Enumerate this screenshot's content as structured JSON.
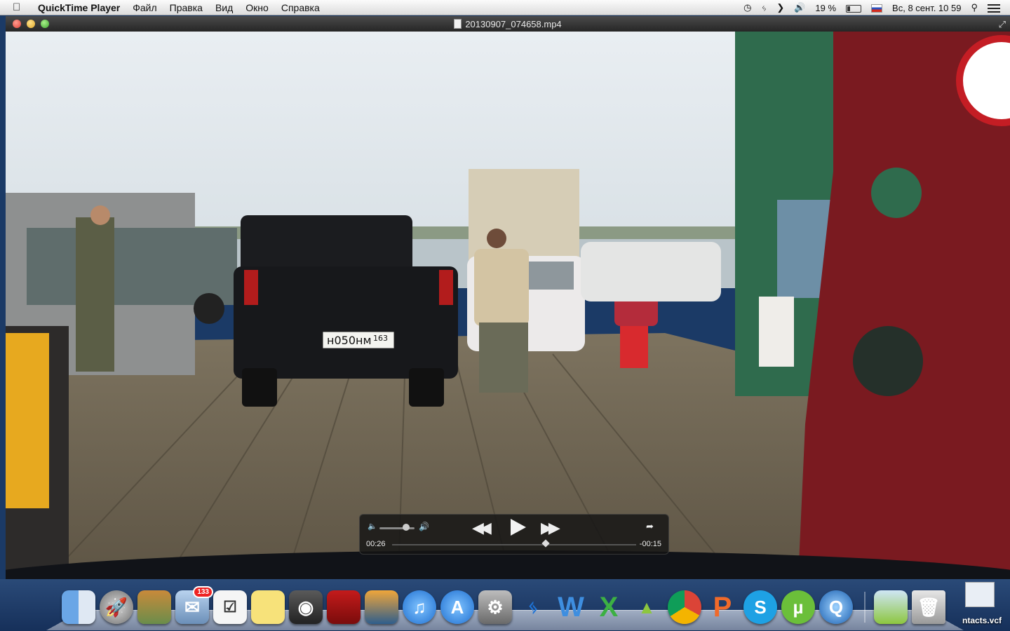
{
  "menubar": {
    "app_name": "QuickTime Player",
    "menus": [
      "Файл",
      "Правка",
      "Вид",
      "Окно",
      "Справка"
    ],
    "status": {
      "battery_percent": "19 %",
      "datetime": "Вс, 8 сент.  10 59"
    }
  },
  "window": {
    "title": "20130907_074658.mp4"
  },
  "player": {
    "time_elapsed": "00:26",
    "time_remaining": "-00:15",
    "volume_level": 0.75,
    "playback_progress": 0.63,
    "state": "paused"
  },
  "scene": {
    "license_plate": "н050нм",
    "plate_region": "163"
  },
  "dock": {
    "mail_badge": "133",
    "apps": [
      "finder",
      "launchpad",
      "image-capture",
      "mail",
      "reminders",
      "stickies",
      "facetime",
      "photo-booth",
      "iphoto",
      "itunes",
      "app-store",
      "system-preferences",
      "bluetooth",
      "word",
      "excel",
      "android",
      "chrome",
      "powerpoint",
      "skype",
      "utorrent",
      "quicktime",
      "android-file-transfer",
      "trash"
    ]
  },
  "desktop": {
    "file_label": "ntacts.vcf"
  },
  "colors": {
    "hud_bg": "#141414",
    "titlebar": "#2e2e2e",
    "menubar": "#ececec"
  }
}
